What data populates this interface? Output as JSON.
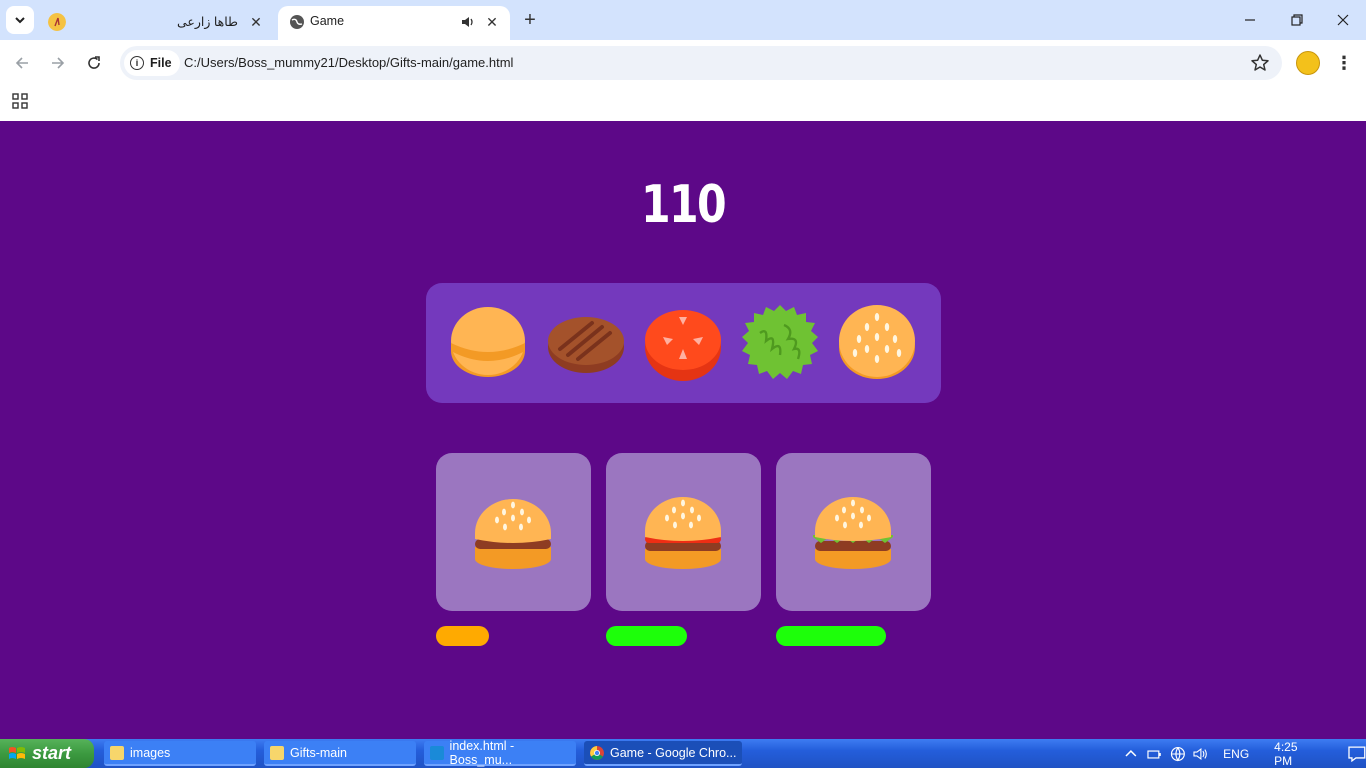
{
  "browser": {
    "tabs": [
      {
        "title": "طاها زارعی",
        "active": false
      },
      {
        "title": "Game",
        "active": true
      }
    ],
    "address": {
      "scheme_chip": "File",
      "url": "C:/Users/Boss_mummy21/Desktop/Gifts-main/game.html"
    }
  },
  "game": {
    "score": "110",
    "ingredients": [
      "bottom-bun",
      "patty",
      "tomato",
      "lettuce",
      "top-bun"
    ],
    "orders": [
      {
        "burger": "bun-patty-bun",
        "timer_remaining": 0.34,
        "timer_color": "#ffaa00"
      },
      {
        "burger": "bun-tomato-patty-bun",
        "timer_remaining": 0.52,
        "timer_color": "#1dff0a"
      },
      {
        "burger": "bun-lettuce-patty-bun",
        "timer_remaining": 0.71,
        "timer_color": "#1dff0a"
      }
    ],
    "colors": {
      "background": "#5d0888",
      "tray": "#7439bd",
      "card": "#9b76c0"
    }
  },
  "taskbar": {
    "start_label": "start",
    "items": [
      {
        "label": "images",
        "icon": "folder-icon"
      },
      {
        "label": "Gifts-main",
        "icon": "folder-icon"
      },
      {
        "label": "index.html - Boss_mu...",
        "icon": "vscode-icon"
      },
      {
        "label": "Game - Google Chro...",
        "icon": "chrome-icon"
      }
    ],
    "language": "ENG",
    "time": "4:25 PM"
  }
}
